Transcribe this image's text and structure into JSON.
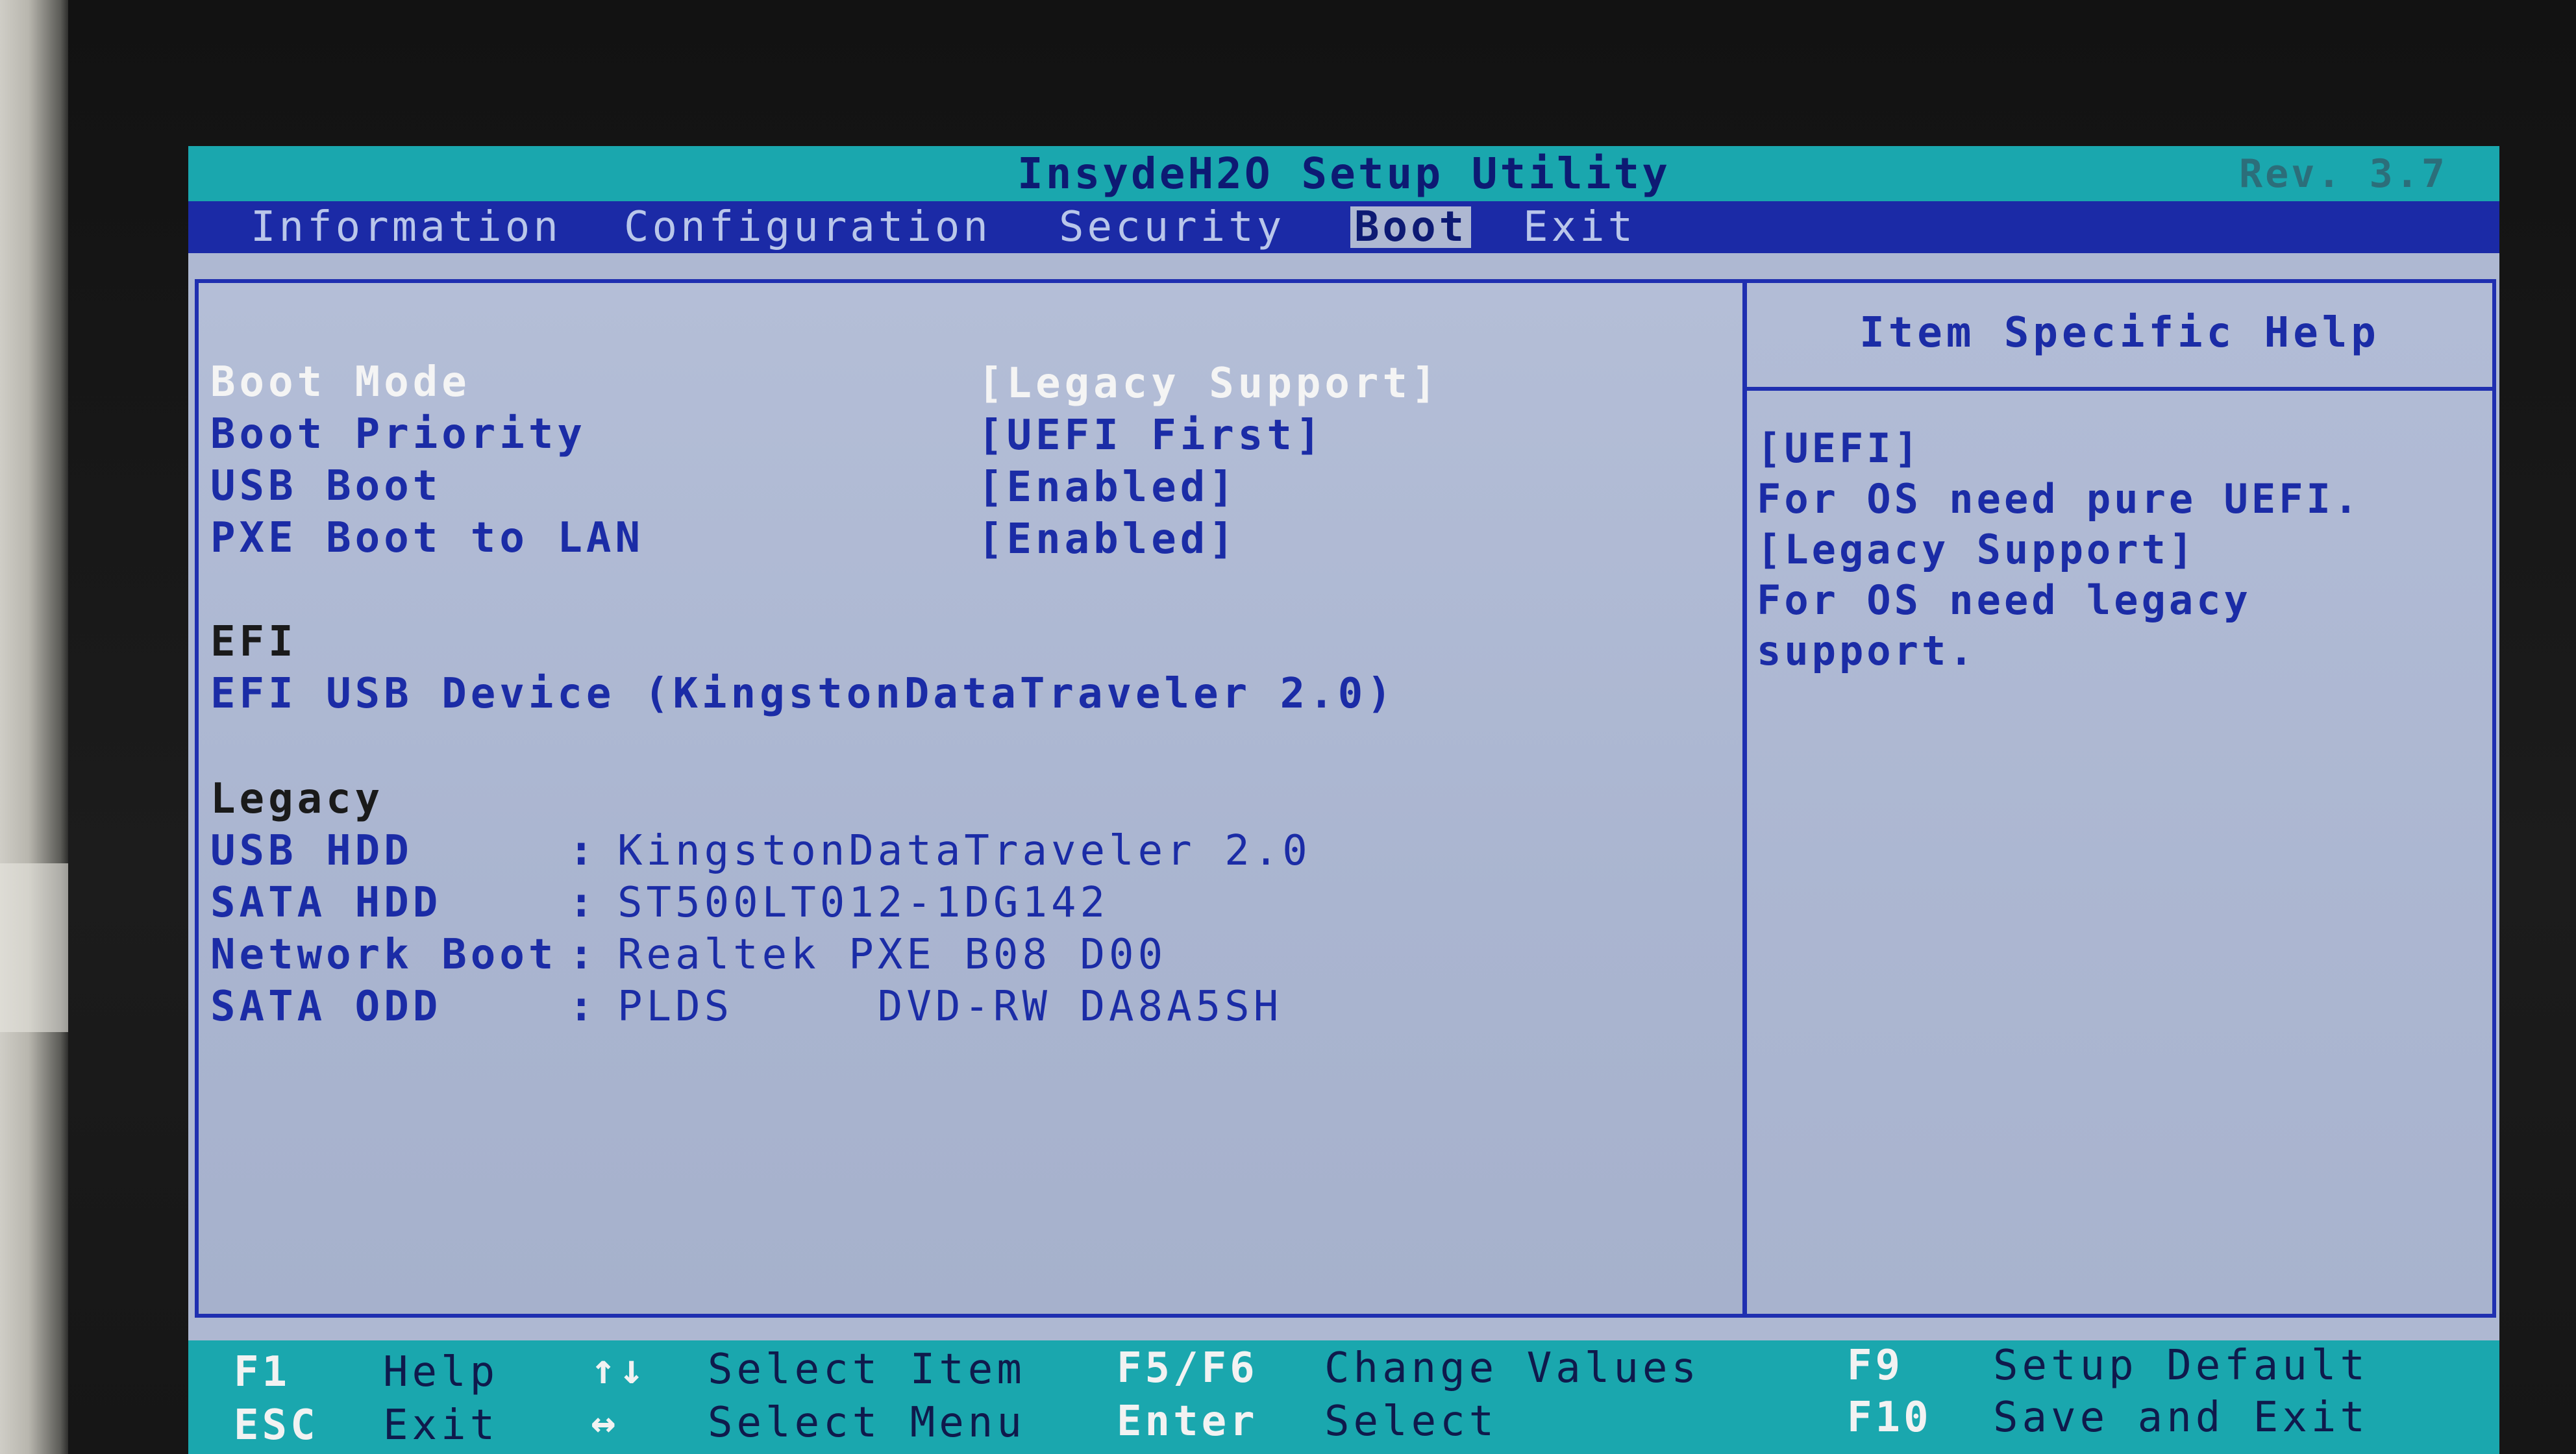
{
  "header": {
    "title": "InsydeH2O Setup Utility",
    "revision": "Rev. 3.7"
  },
  "menu": {
    "tabs": [
      {
        "label": "Information",
        "active": false
      },
      {
        "label": "Configuration",
        "active": false
      },
      {
        "label": "Security",
        "active": false
      },
      {
        "label": "Boot",
        "active": true
      },
      {
        "label": "Exit",
        "active": false
      }
    ]
  },
  "boot": {
    "settings": [
      {
        "label": "Boot Mode",
        "value": "[Legacy Support]"
      },
      {
        "label": "Boot Priority",
        "value": "[UEFI First]"
      },
      {
        "label": "USB Boot",
        "value": "[Enabled]"
      },
      {
        "label": "PXE Boot to LAN",
        "value": "[Enabled]"
      }
    ],
    "efi_heading": "EFI",
    "efi_devices": [
      "EFI USB Device (KingstonDataTraveler 2.0)"
    ],
    "legacy_heading": "Legacy",
    "legacy_devices": [
      {
        "type": "USB HDD",
        "sep": ":",
        "name": "KingstonDataTraveler 2.0"
      },
      {
        "type": "SATA HDD",
        "sep": ":",
        "name": "ST500LT012-1DG142"
      },
      {
        "type": "Network Boot",
        "sep": ":",
        "name": "Realtek PXE B08 D00"
      },
      {
        "type": "SATA ODD",
        "sep": ":",
        "name": "PLDS     DVD-RW DA8A5SH"
      }
    ]
  },
  "help": {
    "title": "Item Specific Help",
    "lines": [
      "[UEFI]",
      "For OS need pure UEFI.",
      "[Legacy Support]",
      "For OS need legacy",
      "support."
    ]
  },
  "footer": {
    "items": [
      {
        "key": "F1",
        "desc": "Help"
      },
      {
        "key": "ESC",
        "desc": "Exit"
      },
      {
        "key": "↑↓",
        "desc": "Select Item"
      },
      {
        "key": "↔",
        "desc": "Select Menu"
      },
      {
        "key": "F5/F6",
        "desc": "Change Values"
      },
      {
        "key": "Enter",
        "desc": "Select"
      },
      {
        "key": "F9",
        "desc": "Setup Default"
      },
      {
        "key": "F10",
        "desc": "Save and Exit"
      }
    ]
  },
  "colors": {
    "title_bar": "#1aa7ae",
    "menu_bar": "#1b2aa6",
    "panel_bg": "#aeb8d2",
    "border": "#1f2fb0",
    "text_blue": "#1b2ca6",
    "text_white": "#f4f4f4"
  }
}
